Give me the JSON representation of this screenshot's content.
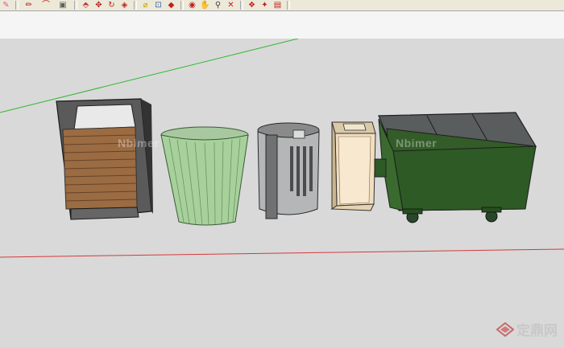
{
  "toolbar": {
    "buttons": [
      {
        "name": "eraser-tool",
        "icon": "eraser-icon",
        "glyph": "✎",
        "color": "#e05aa0"
      },
      {
        "name": "line-tool",
        "icon": "pencil-icon",
        "glyph": "✏",
        "color": "#b01818"
      },
      {
        "name": "arc-tool",
        "icon": "arc-icon",
        "glyph": "⌒",
        "color": "#c02020"
      },
      {
        "name": "rectangle-tool",
        "icon": "rectangle-icon",
        "glyph": "▣",
        "color": "#606060"
      },
      {
        "name": "push-pull-tool",
        "icon": "push-pull-icon",
        "glyph": "⬘",
        "color": "#c03030"
      },
      {
        "name": "move-tool",
        "icon": "move-icon",
        "glyph": "✥",
        "color": "#c02020"
      },
      {
        "name": "rotate-tool",
        "icon": "rotate-icon",
        "glyph": "↻",
        "color": "#c02020"
      },
      {
        "name": "offset-tool",
        "icon": "offset-icon",
        "glyph": "◈",
        "color": "#c02020"
      },
      {
        "name": "tape-measure-tool",
        "icon": "tape-measure-icon",
        "glyph": "⌀",
        "color": "#c8a000"
      },
      {
        "name": "dimension-tool",
        "icon": "dimension-icon",
        "glyph": "⊡",
        "color": "#3060b0"
      },
      {
        "name": "paint-bucket-tool",
        "icon": "paint-bucket-icon",
        "glyph": "◆",
        "color": "#c02020"
      },
      {
        "name": "orbit-tool",
        "icon": "orbit-icon",
        "glyph": "◉",
        "color": "#c02020"
      },
      {
        "name": "pan-tool",
        "icon": "pan-icon",
        "glyph": "✋",
        "color": "#d0a000"
      },
      {
        "name": "zoom-tool",
        "icon": "zoom-icon",
        "glyph": "⚲",
        "color": "#404040"
      },
      {
        "name": "zoom-extents-tool",
        "icon": "zoom-extents-icon",
        "glyph": "✕",
        "color": "#c02020"
      },
      {
        "name": "component-tool",
        "icon": "component-icon",
        "glyph": "❖",
        "color": "#c02020"
      },
      {
        "name": "warehouse-tool",
        "icon": "warehouse-icon",
        "glyph": "✦",
        "color": "#c02020"
      },
      {
        "name": "extension-tool",
        "icon": "extension-icon",
        "glyph": "▤",
        "color": "#c02020"
      }
    ]
  },
  "watermark": {
    "text": "Nbimer"
  },
  "logo": {
    "text": "定鼎网"
  },
  "colors": {
    "viewport_bg": "#d9d9d9",
    "sky_band": "#f5f5f5",
    "green_axis": "#2fb82f",
    "red_axis": "#d43a3a"
  }
}
